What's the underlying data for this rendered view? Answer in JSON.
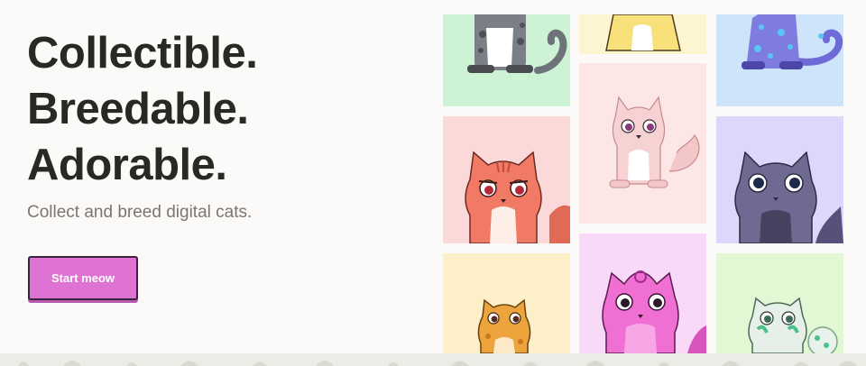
{
  "hero": {
    "headline": [
      "Collectible.",
      "Breedable.",
      "Adorable."
    ],
    "subtitle": "Collect and breed digital cats.",
    "cta_label": "Start meow"
  },
  "colors": {
    "cta_background": "#df73d4",
    "cta_border": "#3a2440",
    "headline_text": "#2a2825",
    "subtitle_text": "#7a7672"
  },
  "cat_tiles": [
    {
      "name": "gray-spotted-cat",
      "background": "#cdf2d4",
      "fur": "#7b7f86"
    },
    {
      "name": "yellow-cat",
      "background": "#fdf5cf",
      "fur": "#f8e07a"
    },
    {
      "name": "blue-spotted-cat",
      "background": "#cde4fb",
      "fur": "#7f7ce0"
    },
    {
      "name": "pink-fluffy-cat",
      "background": "#fde6e6",
      "fur": "#f6d2d3"
    },
    {
      "name": "red-tabby-cat",
      "background": "#fcd9d9",
      "fur": "#f07a65"
    },
    {
      "name": "purple-gray-cat",
      "background": "#dcd8fb",
      "fur": "#6e6a92"
    },
    {
      "name": "orange-cat",
      "background": "#fdf0c8",
      "fur": "#eda43c"
    },
    {
      "name": "magenta-cat",
      "background": "#f8d9f8",
      "fur": "#ef6fd3"
    },
    {
      "name": "green-white-cat",
      "background": "#e2f7d4",
      "fur": "#e6efe8"
    }
  ]
}
